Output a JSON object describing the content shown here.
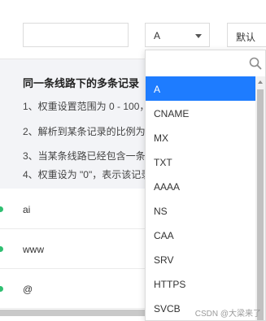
{
  "toolbar": {
    "search_value": "",
    "record_type_selected": "A",
    "line_select_label": "默认"
  },
  "tips": {
    "title": "同一条线路下的多条记录",
    "items": [
      "1、权重设置范围为 0 - 100，",
      "2、解析到某条记录的比例为",
      "3、当某条线路已经包含一条",
      "4、权重设为 \"0\"，表示该记录"
    ]
  },
  "records": [
    {
      "host": "ai",
      "status_color": "#2fbf71"
    },
    {
      "host": "www",
      "status_color": "#2fbf71"
    },
    {
      "host": "@",
      "status_color": "#2fbf71"
    }
  ],
  "dropdown": {
    "search_placeholder": "",
    "options": [
      "A",
      "CNAME",
      "MX",
      "TXT",
      "AAAA",
      "NS",
      "CAA",
      "SRV",
      "HTTPS",
      "SVCB"
    ],
    "selected": "A",
    "search_icon": "search-icon"
  },
  "watermark": "CSDN @大梁来了",
  "colors": {
    "accent": "#1e7cff",
    "status": "#2fbf71",
    "tips_bg": "#f3f4f7"
  }
}
